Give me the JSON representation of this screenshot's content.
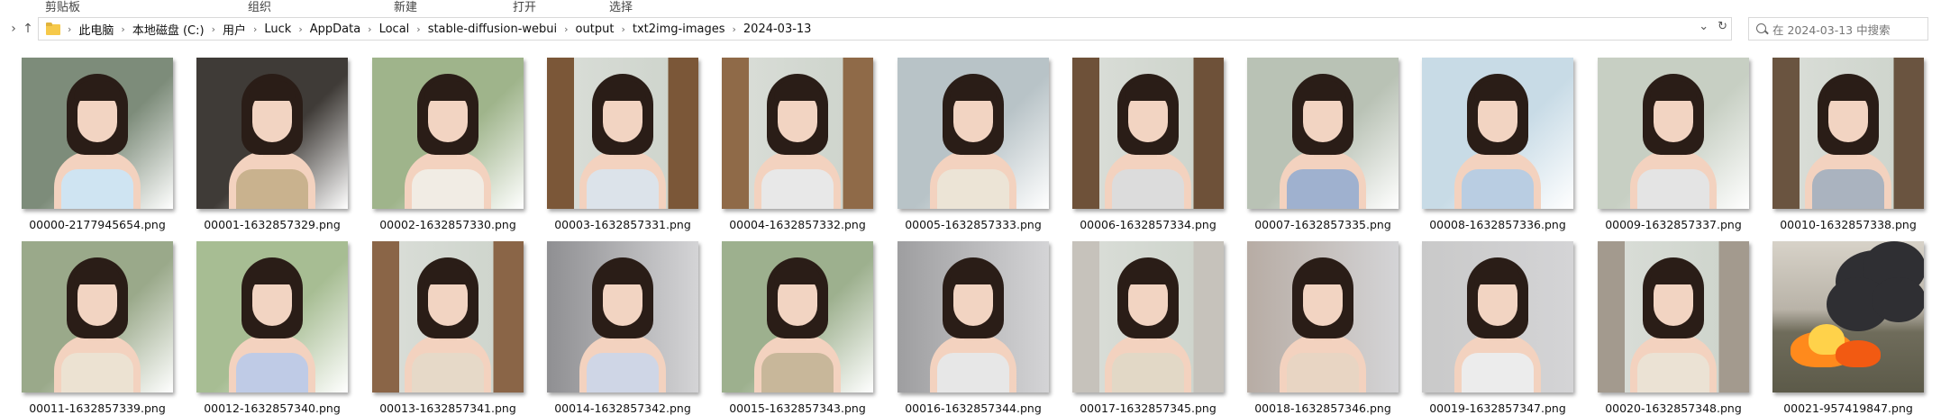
{
  "ribbon": {
    "groups": [
      "剪贴板",
      "组织",
      "新建",
      "打开",
      "选择"
    ]
  },
  "address_bar": {
    "breadcrumbs": [
      "此电脑",
      "本地磁盘 (C:)",
      "用户",
      "Luck",
      "AppData",
      "Local",
      "stable-diffusion-webui",
      "output",
      "txt2img-images",
      "2024-03-13"
    ]
  },
  "search": {
    "placeholder": "在 2024-03-13 中搜索"
  },
  "files": [
    {
      "name": "00000-2177945654.png",
      "scene": "indoor-window",
      "dress_color": "#cfe4f2",
      "bg": "#7d8c7a"
    },
    {
      "name": "00001-1632857329.png",
      "scene": "indoor",
      "dress_color": "#c9b28e",
      "bg": "#3f3b37"
    },
    {
      "name": "00002-1632857330.png",
      "scene": "garden",
      "dress_color": "#f1ece4",
      "bg": "#9fb48b"
    },
    {
      "name": "00003-1632857331.png",
      "scene": "wood-frame",
      "dress_color": "#dce3ea",
      "bg": "#7b5738"
    },
    {
      "name": "00004-1632857332.png",
      "scene": "wood-frame",
      "dress_color": "#e8e8e8",
      "bg": "#8f6a48"
    },
    {
      "name": "00005-1632857333.png",
      "scene": "city-window",
      "dress_color": "#ece4d6",
      "bg": "#b8c3c7"
    },
    {
      "name": "00006-1632857334.png",
      "scene": "wood-frame",
      "dress_color": "#dcdcdc",
      "bg": "#6e5139"
    },
    {
      "name": "00007-1632857335.png",
      "scene": "street",
      "dress_color": "#9fb1cf",
      "bg": "#b9c2b5"
    },
    {
      "name": "00008-1632857336.png",
      "scene": "sea",
      "dress_color": "#b9cde2",
      "bg": "#c8dbe6"
    },
    {
      "name": "00009-1632857337.png",
      "scene": "terrace",
      "dress_color": "#e4e4e4",
      "bg": "#c7cfc3"
    },
    {
      "name": "00010-1632857338.png",
      "scene": "wood-frame",
      "dress_color": "#aab3bf",
      "bg": "#6a5440"
    },
    {
      "name": "00011-1632857339.png",
      "scene": "garden",
      "dress_color": "#ece2d2",
      "bg": "#9aa98a"
    },
    {
      "name": "00012-1632857340.png",
      "scene": "garden",
      "dress_color": "#bfcbe6",
      "bg": "#a7bd93"
    },
    {
      "name": "00013-1632857341.png",
      "scene": "wood-frame",
      "dress_color": "#e6d9c8",
      "bg": "#8a6547"
    },
    {
      "name": "00014-1632857342.png",
      "scene": "studio",
      "dress_color": "#cfd6e6",
      "bg": "#8f8f92"
    },
    {
      "name": "00015-1632857343.png",
      "scene": "garden",
      "dress_color": "#c8b79a",
      "bg": "#9db08e"
    },
    {
      "name": "00016-1632857344.png",
      "scene": "studio",
      "dress_color": "#e7e7e7",
      "bg": "#9e9ea0"
    },
    {
      "name": "00017-1632857345.png",
      "scene": "wood-frame",
      "dress_color": "#e2d8c6",
      "bg": "#c6c2bb"
    },
    {
      "name": "00018-1632857346.png",
      "scene": "studio",
      "dress_color": "#e8d5c3",
      "bg": "#b7aca4"
    },
    {
      "name": "00019-1632857347.png",
      "scene": "studio",
      "dress_color": "#ececec",
      "bg": "#c9c9c9"
    },
    {
      "name": "00020-1632857348.png",
      "scene": "wood-frame",
      "dress_color": "#ebe2d4",
      "bg": "#a39a8e"
    },
    {
      "name": "00021-957419847.png",
      "scene": "fire-smoke",
      "dress_color": "",
      "bg": "#c9c3b8"
    }
  ]
}
